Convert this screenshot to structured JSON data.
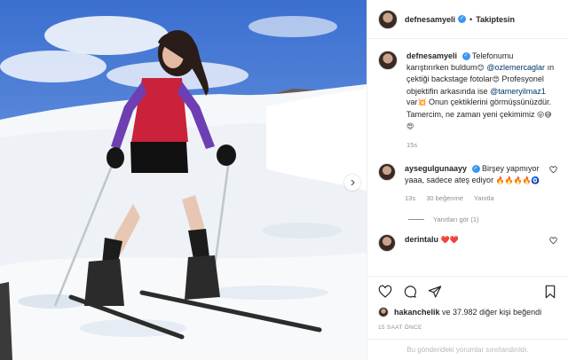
{
  "post": {
    "username": "defnesamyeli",
    "follow_separator": "•",
    "follow_label": "Takiptesin",
    "caption_parts": {
      "p1": "Telefonumu karıştırırken buldum",
      "mention1": "@ozlemercaglar",
      "p2": " ın çektiği backstage fotolar",
      "p3": " Profesyonel objektifin arkasında ise ",
      "mention2": "@tameryilmaz1",
      "p4": " var",
      "p5": " Onun çektiklerini görmüşsünüzdür. Tamercim, ne zaman yeni çekimimiz "
    },
    "caption_emojis": {
      "e1": "😊",
      "e2": "😍",
      "e3": "💥",
      "e4": "😛😅😍"
    },
    "caption_time": "15s"
  },
  "comments": [
    {
      "username": "aysegulgunaayy",
      "text": " Birşey yapmıyor yaaa, sadece ateş ediyor ",
      "emojis": "🔥🔥🔥🔥🧿",
      "time": "13s",
      "likes": "30 beğenme",
      "reply_label": "Yanıtla",
      "replies_label": "Yanıtları gör (1)"
    },
    {
      "username": "derintalu",
      "emojis": "❤️❤️"
    }
  ],
  "footer": {
    "liked_by_user": "hakanchelik",
    "liked_by_rest": " ve 37.982 diğer kişi beğendi",
    "time_ago": "15 SAAT ÖNCE",
    "restricted": "Bu gönderideki yorumlar sınırlandırıldı."
  },
  "icons": [
    "heart-icon",
    "comment-icon",
    "share-icon",
    "save-icon",
    "verified-badge-icon",
    "chevron-right-icon"
  ],
  "colors": {
    "link": "#00376b",
    "muted": "#8e8e8e",
    "verified": "#3897f0",
    "like_red": "#ed4956"
  }
}
